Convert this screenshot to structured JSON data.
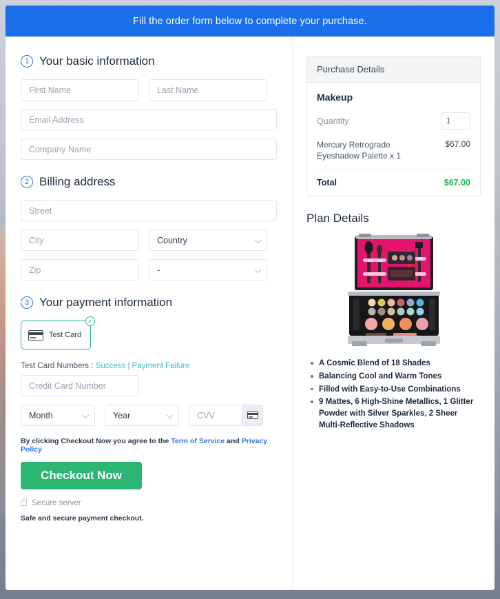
{
  "banner": {
    "text": "Fill the order form below to complete your purchase."
  },
  "steps": [
    {
      "num": "1",
      "title": "Your basic information"
    },
    {
      "num": "2",
      "title": "Billing address"
    },
    {
      "num": "3",
      "title": "Your payment information"
    }
  ],
  "basic_info": {
    "first_name_placeholder": "First Name",
    "last_name_placeholder": "Last Name",
    "email_placeholder": "Email Address",
    "company_placeholder": "Company Name",
    "first_name_value": "",
    "last_name_value": "",
    "email_value": "",
    "company_value": ""
  },
  "billing": {
    "street_placeholder": "Street",
    "city_placeholder": "City",
    "country_selected": "Country",
    "zip_placeholder": "Zip",
    "state_selected": "-"
  },
  "payment": {
    "method_tile_label": "Test Card",
    "method_icon": "credit-card-icon",
    "selected_badge_icon": "check-circle-icon",
    "test_numbers_label": "Test Card Numbers :",
    "success_link": "Success",
    "separator": "|",
    "failure_link": "Payment Failure",
    "card_number_placeholder": "Credit Card Number",
    "month_selected": "Month",
    "year_selected": "Year",
    "cvv_placeholder": "CVV",
    "cvv_icon": "credit-card-icon"
  },
  "terms": {
    "prefix": "By clicking Checkout Now you agree to the",
    "tos_link": "Term of Service",
    "and": "and",
    "privacy_link": "Privacy Policy"
  },
  "checkout": {
    "label": "Checkout Now"
  },
  "secure": {
    "icon": "lock-icon",
    "label": "Secure server",
    "note": "Safe and secure payment checkout."
  },
  "purchase_details": {
    "heading": "Purchase Details",
    "product_name": "Makeup",
    "quantity_label": "Quantity",
    "quantity_value": "1",
    "line_item_desc": "Mercury Retrograde Eyeshadow Palette x 1",
    "line_item_price": "$67.00",
    "total_label": "Total",
    "total_amount": "$67.00"
  },
  "plan_details": {
    "heading": "Plan Details",
    "image_alt": "makeup-case-product-image",
    "features": [
      "A Cosmic Blend of 18 Shades",
      "Balancing Cool and Warm Tones",
      "Filled with Easy-to-Use Combinations",
      "9 Mattes, 6 High-Shine Metallics, 1 Glitter Powder with Silver Sparkles, 2 Sheer Multi-Reflective Shadows"
    ]
  },
  "colors": {
    "banner_blue": "#1a6eea",
    "accent_blue": "#2f74e0",
    "success_green": "#2bb673",
    "total_green": "#1db954",
    "teal_link": "#39c2c9"
  }
}
